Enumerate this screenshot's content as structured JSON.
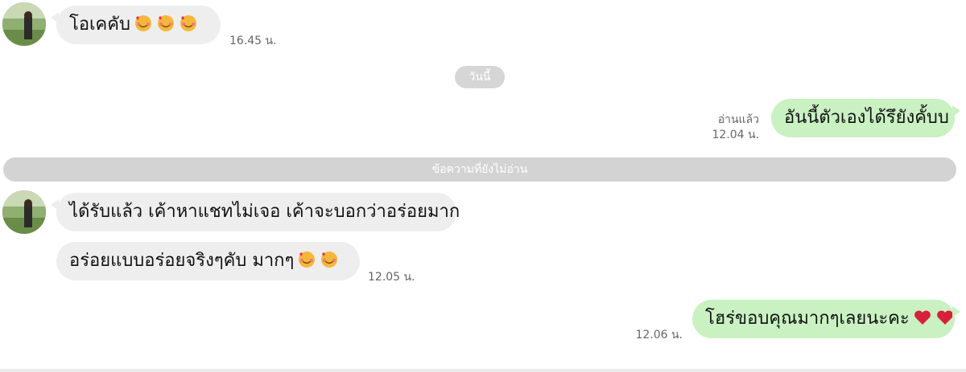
{
  "messages": [
    {
      "text": "โอเคคับ",
      "time": "16.45 น."
    },
    {
      "date_divider": "วันนี้"
    },
    {
      "text": "อันนี้ตัวเองได้รึยังคั้บบ",
      "status": "อ่านแล้ว",
      "time": "12.04 น."
    },
    {
      "unread_divider": "ข้อความที่ยังไม่อ่าน"
    },
    {
      "text": "ได้รับแล้ว เค้าหาแชทไม่เจอ เค้าจะบอกว่าอร่อยมาก"
    },
    {
      "text": "อร่อยแบบอร่อยจริงๆคับ มากๆ",
      "time": "12.05 น."
    },
    {
      "text": "โฮร่ขอบคุณมากๆเลยนะคะ",
      "time": "12.06 น."
    }
  ],
  "icons": [
    "avatar-photo",
    "smiling-face-with-hearts-emoji",
    "red-heart-emoji"
  ],
  "colors": {
    "incoming_bubble": "#eeeeef",
    "outgoing_bubble": "#c9f1c2",
    "divider": "#d3d3d3"
  }
}
